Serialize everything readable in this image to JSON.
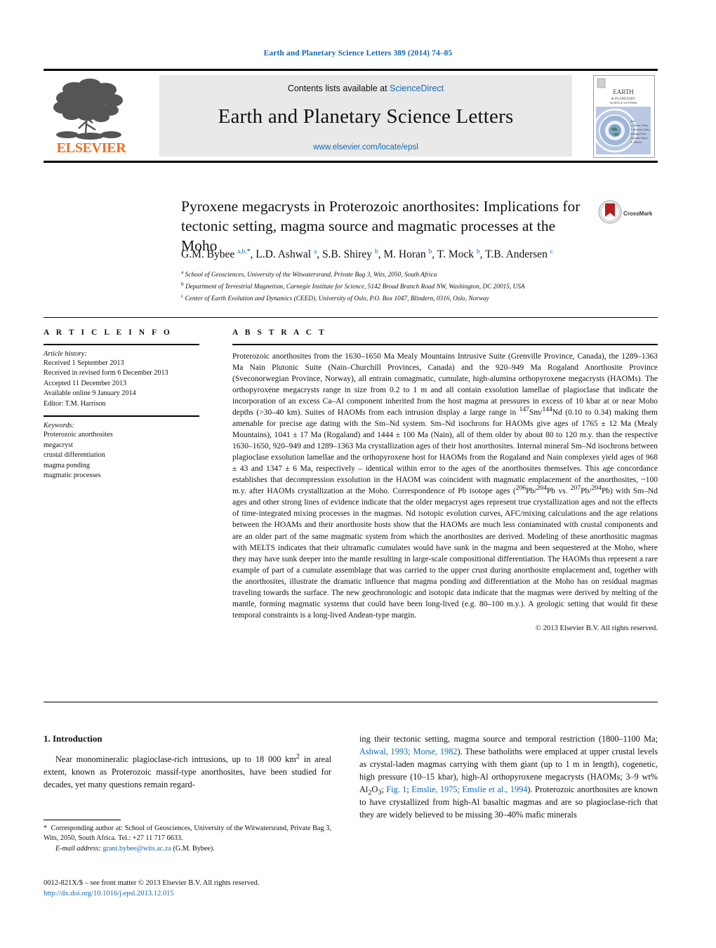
{
  "running_head": "Earth and Planetary Science Letters 389 (2014) 74–85",
  "masthead": {
    "contents_prefix": "Contents lists available at ",
    "sciencedirect": "ScienceDirect",
    "journal_title": "Earth and Planetary Science Letters",
    "journal_url": "www.elsevier.com/locate/epsl",
    "publisher": "ELSEVIER",
    "cover_title_line1": "EARTH",
    "cover_title_line2": "& PLANETARY",
    "cover_title_line3": "SCIENCE LETTERS"
  },
  "article": {
    "title_line1": "Pyroxene megacrysts in Proterozoic anorthosites: Implications for",
    "title_line2": "tectonic setting, magma source and magmatic processes at the Moho",
    "crossmark_label": "CrossMark",
    "authors_html": "G.M. Bybee <sup>a,b,</sup><sup class=\"star\">*</sup>, L.D. Ashwal <sup>a</sup>, S.B. Shirey <sup>b</sup>, M. Horan <sup>b</sup>, T. Mock <sup>b</sup>, T.B. Andersen <sup>c</sup>",
    "affiliations": [
      {
        "mark": "a",
        "text": "School of Geosciences, University of the Witwatersrand, Private Bag 3, Wits, 2050, South Africa"
      },
      {
        "mark": "b",
        "text": "Department of Terrestrial Magnetism, Carnegie Institute for Science, 5142 Broad Branch Road NW, Washington, DC 20015, USA"
      },
      {
        "mark": "c",
        "text": "Center of Earth Evolution and Dynamics (CEED), University of Oslo, P.O. Box 1047, Blindern, 0316, Oslo, Norway"
      }
    ]
  },
  "info_column": {
    "heading": "A R T I C L E    I N F O",
    "history_title": "Article history:",
    "history_lines": [
      "Received 1 September 2013",
      "Received in revised form 6 December 2013",
      "Accepted 11 December 2013",
      "Available online 9 January 2014",
      "Editor: T.M. Harrison"
    ],
    "keywords_title": "Keywords:",
    "keywords": [
      "Proterozoic anorthosites",
      "megacryst",
      "crustal differentiation",
      "magma ponding",
      "magmatic processes"
    ]
  },
  "abstract": {
    "heading": "A B S T R A C T",
    "text_html": "Proterozoic anorthosites from the 1630–1650 Ma Mealy Mountains Intrusive Suite (Grenville Province, Canada), the 1289–1363 Ma Nain Plutonic Suite (Nain–Churchill Provinces, Canada) and the 920–949 Ma Rogaland Anorthosite Province (Sveconorwegian Province, Norway), all entrain comagmatic, cumulate, high-alumina orthopyroxene megacrysts (HAOMs). The orthopyroxene megacrysts range in size from 0.2 to 1 m and all contain exsolution lamellae of plagioclase that indicate the incorporation of an excess Ca–Al component inherited from the host magma at pressures in excess of 10 kbar at or near Moho depths (&gt;30–40 km). Suites of HAOMs from each intrusion display a large range in <sup>147</sup>Sm/<sup>144</sup>Nd (0.10 to 0.34) making them amenable for precise age dating with the Sm–Nd system. Sm–Nd isochrons for HAOMs give ages of 1765 ± 12 Ma (Mealy Mountains), 1041 ± 17 Ma (Rogaland) and 1444 ± 100 Ma (Nain), all of them older by about 80 to 120 m.y. than the respective 1630–1650, 920–949 and 1289–1363 Ma crystallization ages of their host anorthosites. Internal mineral Sm–Nd isochrons between plagioclase exsolution lamellae and the orthopyroxene host for HAOMs from the Rogaland and Nain complexes yield ages of 968 ± 43 and 1347 ± 6 Ma, respectively – identical within error to the ages of the anorthosites themselves. This age concordance establishes that decompression exsolution in the HAOM was coincident with magmatic emplacement of the anorthosites, ~100 m.y. after HAOMs crystallization at the Moho. Correspondence of Pb isotope ages (<sup>206</sup>Pb/<sup>204</sup>Pb vs. <sup>207</sup>Pb/<sup>204</sup>Pb) with Sm–Nd ages and other strong lines of evidence indicate that the older megacryst ages represent true crystallization ages and not the effects of time-integrated mixing processes in the magmas. Nd isotopic evolution curves, AFC/mixing calculations and the age relations between the HOAMs and their anorthosite hosts show that the HAOMs are much less contaminated with crustal components and are an older part of the same magmatic system from which the anorthosites are derived. Modeling of these anorthositic magmas with MELTS indicates that their ultramafic cumulates would have sunk in the magma and been sequestered at the Moho, where they may have sunk deeper into the mantle resulting in large-scale compositional differentiation. The HAOMs thus represent a rare example of part of a cumulate assemblage that was carried to the upper crust during anorthosite emplacement and, together with the anorthosites, illustrate the dramatic influence that magma ponding and differentiation at the Moho has on residual magmas traveling towards the surface. The new geochronologic and isotopic data indicate that the magmas were derived by melting of the mantle, forming magmatic systems that could have been long-lived (e.g. 80–100 m.y.). A geologic setting that would fit these temporal constraints is a long-lived Andean-type margin.",
    "copyright": "© 2013 Elsevier B.V. All rights reserved."
  },
  "introduction": {
    "heading": "1. Introduction",
    "left_para_html": "Near monomineralic plagioclase-rich intrusions, up to 18 000 km<sup>2</sup> in areal extent, known as Proterozoic massif-type anorthosites, have been studied for decades, yet many questions remain regard-",
    "right_para_html": "ing their tectonic setting, magma source and temporal restriction (1800–1100 Ma; <span class=\"cite\">Ashwal, 1993; Morse, 1982</span>). These batholiths were emplaced at upper crustal levels as crystal-laden magmas carrying with them giant (up to 1 m in length), cogenetic, high pressure (10–15 kbar), high-Al orthopyroxene megacrysts (HAOMs; 3–9 wt% Al<sub>2</sub>O<sub>3</sub>; <span class=\"cite\">Fig. 1</span>; <span class=\"cite\">Emslie, 1975; Emslie et al., 1994</span>). Proterozoic anorthosites are known to have crystallized from high-Al basaltic magmas and are so plagioclase-rich that they are widely believed to be missing 30–40% mafic minerals"
  },
  "footnotes": {
    "corresponding_html": "<span class=\"star\">*</span>&nbsp; Corresponding author at: School of Geosciences, University of the Witwatersrand, Private Bag 3, Wits, 2050, South Africa. Tel.: +27 11 717 6633.",
    "email_label": "E-mail address:",
    "email": "grant.bybee@wits.ac.za",
    "email_suffix": "(G.M. Bybee)."
  },
  "imprint": {
    "issn_line": "0012-821X/$ – see front matter © 2013 Elsevier B.V. All rights reserved.",
    "doi": "http://dx.doi.org/10.1016/j.epsl.2013.12.015"
  },
  "colors": {
    "link": "#1268b3",
    "elsevier_orange": "#ef6f22",
    "masthead_bg": "#e9e9e9"
  }
}
